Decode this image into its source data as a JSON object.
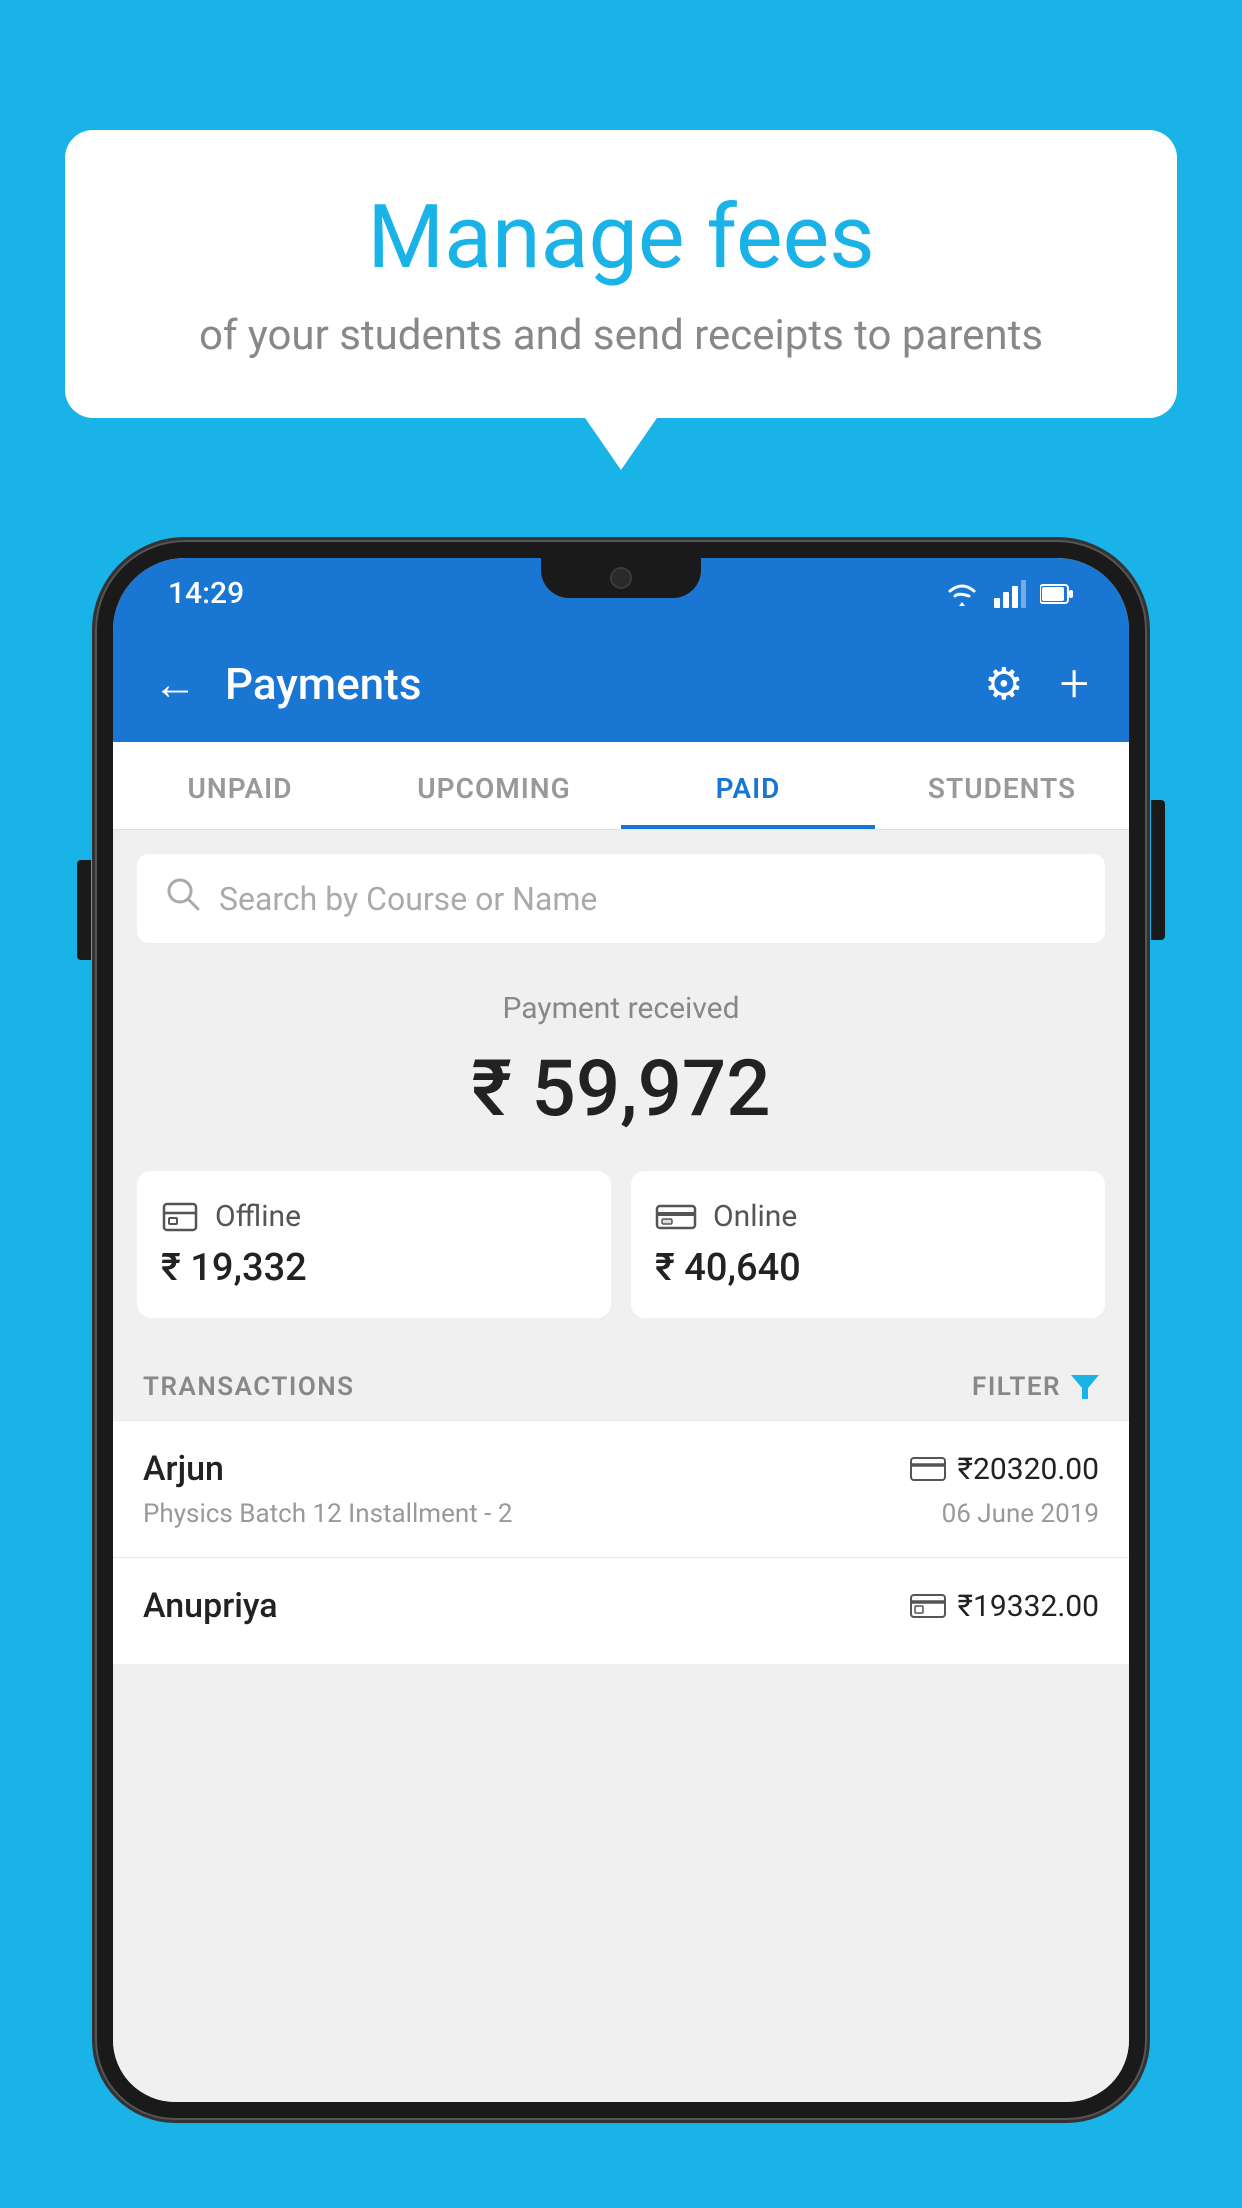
{
  "background_color": "#1ab3e8",
  "speech_bubble": {
    "title": "Manage fees",
    "subtitle": "of your students and send receipts to parents"
  },
  "phone": {
    "status_bar": {
      "time": "14:29",
      "icons": [
        "wifi",
        "signal",
        "battery"
      ]
    },
    "app_bar": {
      "back_label": "←",
      "title": "Payments",
      "gear_icon": "⚙",
      "add_icon": "+"
    },
    "tabs": [
      {
        "label": "UNPAID",
        "active": false
      },
      {
        "label": "UPCOMING",
        "active": false
      },
      {
        "label": "PAID",
        "active": true
      },
      {
        "label": "STUDENTS",
        "active": false
      }
    ],
    "search": {
      "placeholder": "Search by Course or Name"
    },
    "payment_received": {
      "label": "Payment received",
      "amount": "₹ 59,972"
    },
    "payment_cards": [
      {
        "icon": "offline",
        "label": "Offline",
        "amount": "₹ 19,332"
      },
      {
        "icon": "online",
        "label": "Online",
        "amount": "₹ 40,640"
      }
    ],
    "transactions_section": {
      "label": "TRANSACTIONS",
      "filter_label": "FILTER"
    },
    "transactions": [
      {
        "name": "Arjun",
        "detail": "Physics Batch 12 Installment - 2",
        "amount": "₹20320.00",
        "date": "06 June 2019",
        "payment_type": "online"
      },
      {
        "name": "Anupriya",
        "detail": "",
        "amount": "₹19332.00",
        "date": "",
        "payment_type": "offline"
      }
    ]
  }
}
